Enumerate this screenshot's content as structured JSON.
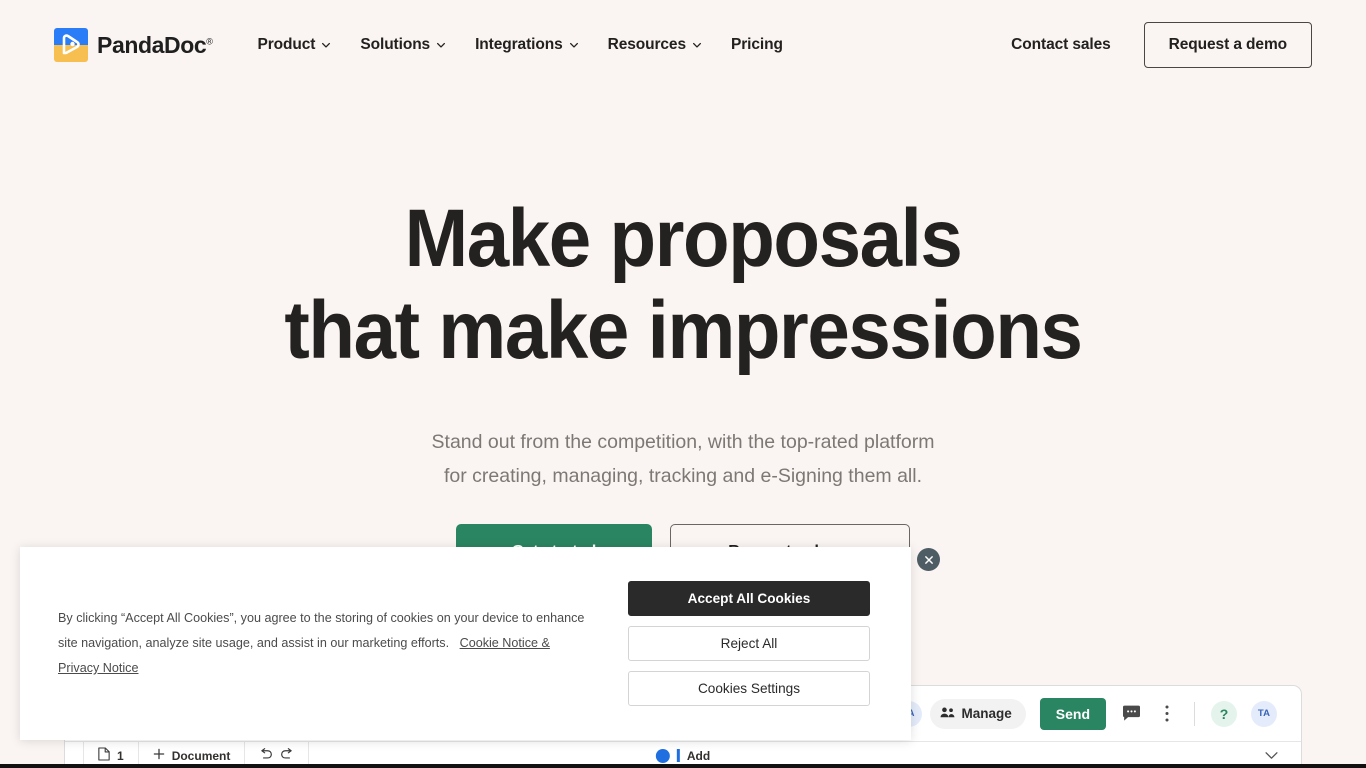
{
  "header": {
    "brand": {
      "name": "PandaDoc",
      "registered": "®",
      "logo_icon": "pandadoc-logo-icon"
    },
    "nav": [
      {
        "label": "Product",
        "has_dropdown": true
      },
      {
        "label": "Solutions",
        "has_dropdown": true
      },
      {
        "label": "Integrations",
        "has_dropdown": true
      },
      {
        "label": "Resources",
        "has_dropdown": true
      },
      {
        "label": "Pricing",
        "has_dropdown": false
      }
    ],
    "contact_sales": "Contact sales",
    "request_demo": "Request a demo"
  },
  "hero": {
    "title_line1": "Make proposals",
    "title_line2": "that make impressions",
    "sub_line1": "Stand out from the competition, with the top-rated platform",
    "sub_line2": "for creating, managing, tracking and e-Signing them all.",
    "cta_primary": "Get started",
    "cta_secondary": "Request a demo"
  },
  "product_preview": {
    "avatar_left": "TA",
    "manage_label": "Manage",
    "send_label": "Send",
    "help_label": "?",
    "avatar_right": "TA",
    "page_number": "1",
    "document_label": "Document",
    "add_label": "Add",
    "icons": {
      "manage": "people-icon",
      "comment": "comment-icon",
      "more": "more-vertical-icon",
      "page": "page-icon",
      "plus": "plus-icon",
      "undo": "undo-icon",
      "redo": "redo-icon",
      "chevron": "chevron-down-icon"
    }
  },
  "cookie_banner": {
    "text_part1": "By clicking “Accept All Cookies”, you agree to the storing of cookies on your device to enhance site navigation, analyze site usage, and assist in our marketing efforts.",
    "link_cookie": "Cookie Notice &",
    "link_privacy": "Privacy Notice",
    "accept_all": "Accept All Cookies",
    "reject_all": "Reject All",
    "cookies_settings": "Cookies Settings",
    "close_icon": "close-icon"
  },
  "colors": {
    "page_background": "#faf5f3",
    "brand_green": "#2a8562",
    "text_dark": "#242220",
    "text_muted": "#7d7873",
    "banner_dark": "#2a2a2a",
    "logo_blue": "#2b7cf7",
    "logo_yellow": "#f6bf4f"
  }
}
